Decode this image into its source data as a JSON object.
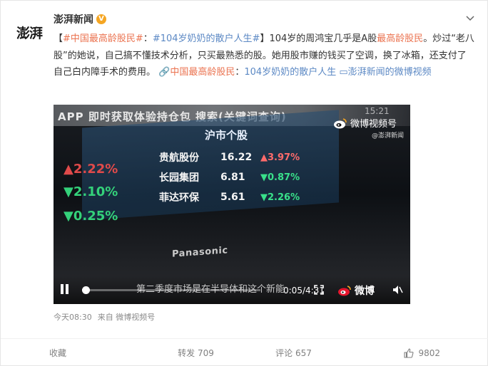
{
  "post": {
    "author": {
      "avatar_text": "澎湃",
      "name": "澎湃新闻",
      "verified_mark": "V"
    },
    "text": {
      "lead_bracket_open": "【",
      "hashtag1": "#中国最高龄股民#",
      "sep1": "：",
      "hashtag2": "#104岁奶奶的散户人生#",
      "lead_bracket_close": "】",
      "body1": "104岁的周鸿宝几乎是A股",
      "hl1": "最高龄股民",
      "body2": "。炒过“老八股”的她说，自己搞不懂技术分析，只买最熟悉的股。她用股市赚的钱买了空调，换了冰箱，还支付了自己白内障手术的费用。",
      "link_icon": "🔗",
      "link1": "中国最高龄股民",
      "sep2": "：",
      "link2": "104岁奶奶的散户人生",
      "video_icon": "▭",
      "link3": "澎湃新闻的微博视频"
    },
    "timestamp": "今天08:30",
    "source": "来自 微博视频号"
  },
  "video": {
    "top_band_text": "APP 即时获取体验持仓包 搜索(关键词查询)",
    "right_tv_text": "15:21",
    "watermark_brand": "微博视频号",
    "watermark_sub": "@澎湃新闻",
    "market_title": "沪市个股",
    "left_ticks": [
      {
        "text": "▲2.22%",
        "color": "red"
      },
      {
        "text": "▼2.10%",
        "color": "green"
      },
      {
        "text": "▼0.25%",
        "color": "green"
      }
    ],
    "stocks": [
      {
        "name": "贵航股份",
        "price": "16.22",
        "change": "▲3.97%",
        "dir": "up"
      },
      {
        "name": "长园集团",
        "price": "6.81",
        "change": "▼0.87%",
        "dir": "down"
      },
      {
        "name": "菲达环保",
        "price": "5.61",
        "change": "▼2.26%",
        "dir": "down"
      }
    ],
    "tv_brand": "Panasonic",
    "subtitle": "第二季度市场是在半导体和这个新能",
    "time": "0:05/4:31",
    "progress": 0.02,
    "wm_bottom_text": "微博"
  },
  "actions": {
    "favorite": "收藏",
    "repost": "转发 709",
    "comment": "评论 657",
    "like": "9802"
  },
  "colors": {
    "accent": "#eb7350",
    "topic_blue": "#5b88c4",
    "verified": "#f5a623",
    "up": "#ff6b6b",
    "down": "#39e08a"
  }
}
